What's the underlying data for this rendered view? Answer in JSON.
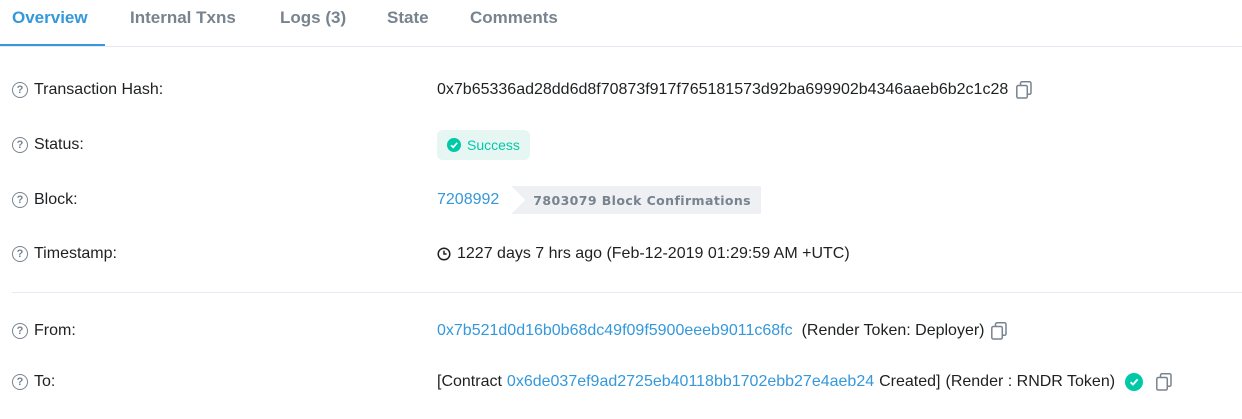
{
  "tabs": [
    {
      "label": "Overview",
      "active": true
    },
    {
      "label": "Internal Txns"
    },
    {
      "label": "Logs (3)"
    },
    {
      "label": "State"
    },
    {
      "label": "Comments"
    }
  ],
  "rows": {
    "hash": {
      "label": "Transaction Hash:",
      "value": "0x7b65336ad28dd6d8f70873f917f765181573d92ba699902b4346aaeb6b2c1c28"
    },
    "status": {
      "label": "Status:",
      "value": "Success"
    },
    "block": {
      "label": "Block:",
      "value": "7208992",
      "confirmations": "7803079 Block Confirmations"
    },
    "timestamp": {
      "label": "Timestamp:",
      "value": "1227 days 7 hrs ago (Feb-12-2019 01:29:59 AM +UTC)"
    },
    "from": {
      "label": "From:",
      "address": "0x7b521d0d16b0b68dc49f09f5900eeeb9011c68fc",
      "name": "(Render Token: Deployer)"
    },
    "to": {
      "label": "To:",
      "prefix": "[Contract",
      "address": "0x6de037ef9ad2725eb40118bb1702ebb27e4aeb24",
      "suffix": "Created]",
      "name": "(Render : RNDR Token)"
    }
  },
  "colors": {
    "accent": "#3498db",
    "success": "#00c9a7",
    "muted": "#77838f"
  },
  "icons": [
    "question-icon",
    "copy-icon",
    "check-circle-icon",
    "clock-icon"
  ]
}
